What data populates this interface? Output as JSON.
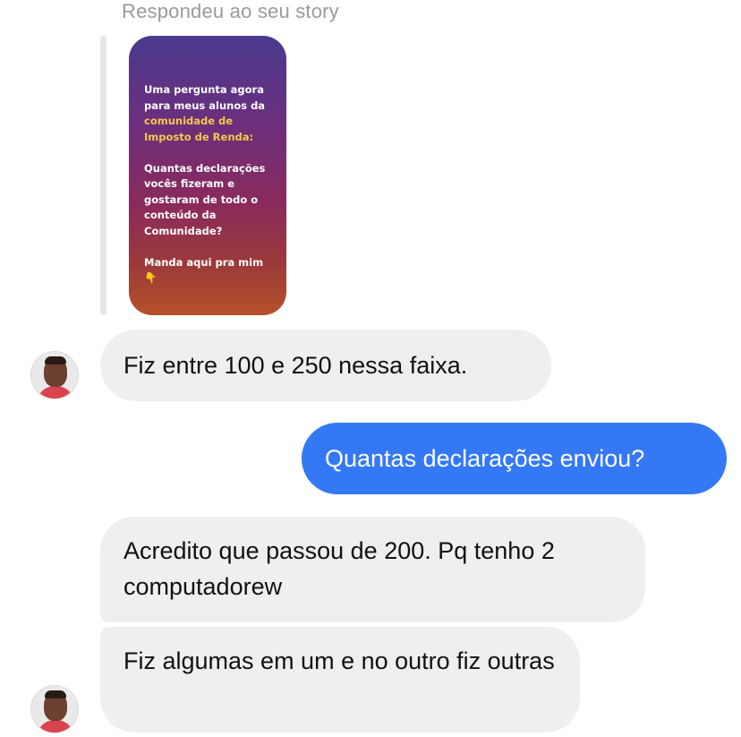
{
  "story": {
    "caption": "Respondeu ao seu story",
    "line1": "Uma pergunta agora",
    "line2": "para meus alunos da",
    "line3": "comunidade de",
    "line4": "Imposto de Renda:",
    "line5": "Quantas declarações",
    "line6": "vocês fizeram e",
    "line7": "gostaram de todo o",
    "line8": "conteúdo da",
    "line9": "Comunidade?",
    "line10": "Manda aqui pra mim 👇"
  },
  "messages": [
    {
      "sender": "contact",
      "text": "Fiz entre 100 e 250 nessa faixa."
    },
    {
      "sender": "me",
      "text": "Quantas declarações enviou?"
    },
    {
      "sender": "contact",
      "text": "Acredito que passou de 200. Pq tenho 2 computadorew"
    },
    {
      "sender": "contact",
      "text": "Fiz algumas em um e no outro fiz outras"
    }
  ],
  "colors": {
    "incoming_bubble": "#efefef",
    "outgoing_bubble": "#3478f6",
    "story_highlight": "#f5c74a"
  }
}
